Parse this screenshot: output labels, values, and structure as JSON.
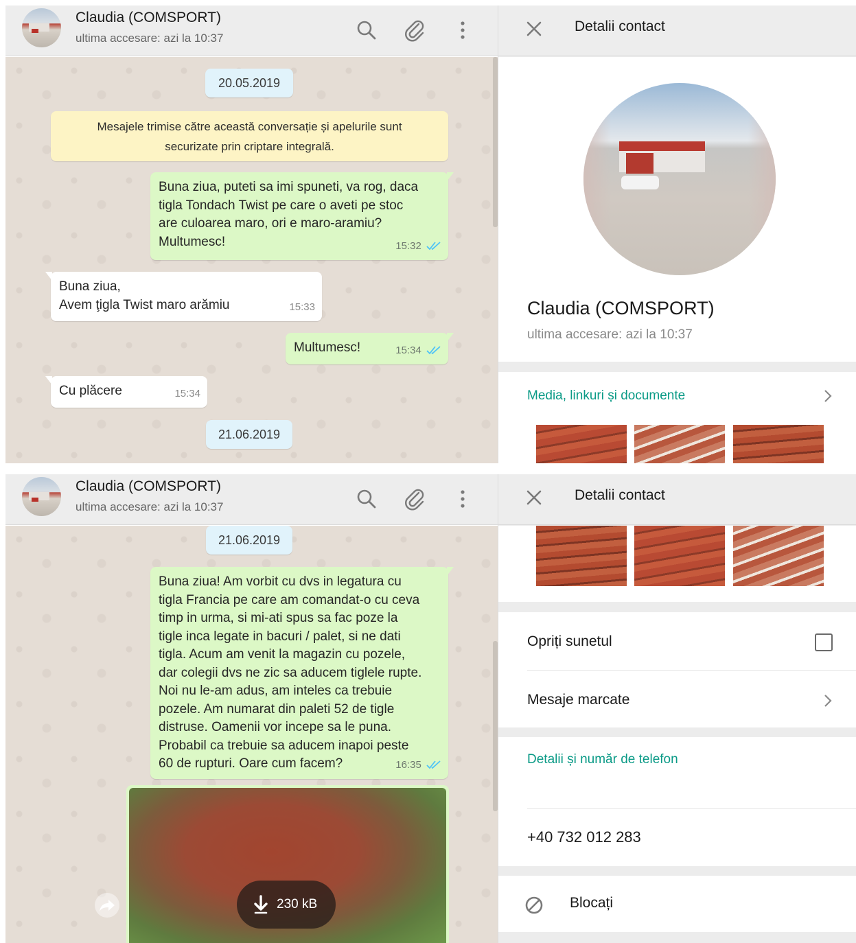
{
  "contact": {
    "name": "Claudia (COMSPORT)",
    "last_seen": "ultima accesare: azi la 10:37"
  },
  "info_panel": {
    "title": "Detalii contact",
    "media_label": "Media, linkuri și documente",
    "mute_label": "Opriți sunetul",
    "starred_label": "Mesaje marcate",
    "phone_section_label": "Detalii și număr de telefon",
    "phone": "+40 732 012 283",
    "block_label": "Blocați"
  },
  "screen1": {
    "date1": "20.05.2019",
    "encryption_note": "Mesajele trimise către această conversație și apelurile sunt\nsecurizate prin criptare integrală.",
    "messages": [
      {
        "dir": "out",
        "text": "Buna ziua, puteti sa imi spuneti, va rog, daca\ntigla Tondach Twist pe care o aveti pe stoc\nare culoarea maro, ori e maro-aramiu?\nMultumesc!",
        "time": "15:32"
      },
      {
        "dir": "in",
        "text": "Buna ziua,\nAvem ţigla Twist maro arămiu",
        "time": "15:33"
      },
      {
        "dir": "out",
        "text": "Multumesc!",
        "time": "15:34"
      },
      {
        "dir": "in",
        "text": "Cu plăcere",
        "time": "15:34"
      }
    ],
    "date2": "21.06.2019"
  },
  "screen2": {
    "date": "21.06.2019",
    "message": {
      "dir": "out",
      "text": "Buna ziua! Am vorbit cu dvs in legatura cu\ntigla Francia pe care am comandat-o cu ceva\ntimp in urma, si mi-ati spus sa fac poze la\ntigle inca legate in bacuri / palet, si ne dati\ntigla. Acum am venit la magazin cu pozele,\ndar colegii dvs ne zic sa aducem tiglele rupte.\nNoi nu le-am adus, am inteles ca trebuie\npozele. Am numarat din paleti 52 de tigle\ndistruse. Oamenii vor incepe sa le puna.\nProbabil ca trebuie sa aducem inapoi peste\n60 de rupturi. Oare cum facem?",
      "time": "16:35"
    },
    "image_download_size": "230 kB"
  },
  "icons": [
    "search-icon",
    "attach-icon",
    "menu-icon",
    "close-icon",
    "chevron-right-icon",
    "double-check-icon",
    "download-icon",
    "forward-icon",
    "block-icon"
  ],
  "colors": {
    "header_bg": "#ededed",
    "chat_wallpaper": "#e5ddd5",
    "outgoing_bubble": "#dcf8c6",
    "incoming_bubble": "#ffffff",
    "date_pill": "#e1f3fb",
    "encryption_note": "#fdf4c5",
    "accent_teal": "#0a9a86",
    "read_ticks": "#4fc3f7"
  }
}
